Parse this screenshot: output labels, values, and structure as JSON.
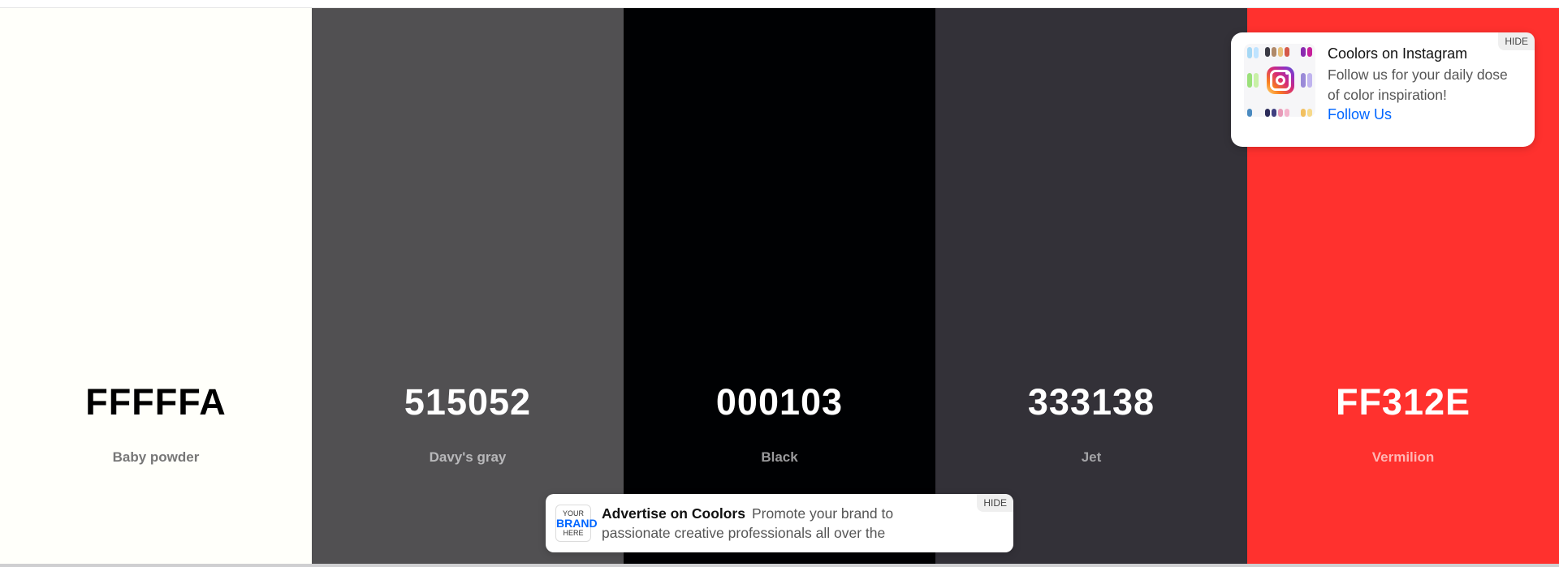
{
  "palette": [
    {
      "hex": "FFFFFA",
      "name": "Baby powder",
      "bg": "#FFFFFA",
      "hex_color": "#000000",
      "name_color": "#777777"
    },
    {
      "hex": "515052",
      "name": "Davy's gray",
      "bg": "#515052",
      "hex_color": "#ffffff",
      "name_color": "#b8b8ba"
    },
    {
      "hex": "000103",
      "name": "Black",
      "bg": "#000103",
      "hex_color": "#ffffff",
      "name_color": "#9a9a9c"
    },
    {
      "hex": "333138",
      "name": "Jet",
      "bg": "#333138",
      "hex_color": "#ffffff",
      "name_color": "#a3a3a6"
    },
    {
      "hex": "FF312E",
      "name": "Vermilion",
      "bg": "#FF312E",
      "hex_color": "#ffffff",
      "name_color": "#ffb6b4"
    }
  ],
  "instagram_popup": {
    "title": "Coolors on Instagram",
    "description": "Follow us for your daily dose of color inspiration!",
    "link": "Follow Us",
    "hide": "HIDE",
    "icon": "instagram-icon"
  },
  "ad": {
    "logo_line1": "YOUR",
    "logo_line2": "BRAND",
    "logo_line3": "HERE",
    "title": "Advertise on Coolors",
    "text": "Promote your brand to passionate creative professionals all over the",
    "hide": "HIDE"
  },
  "colors": {
    "link": "#0066ff"
  }
}
